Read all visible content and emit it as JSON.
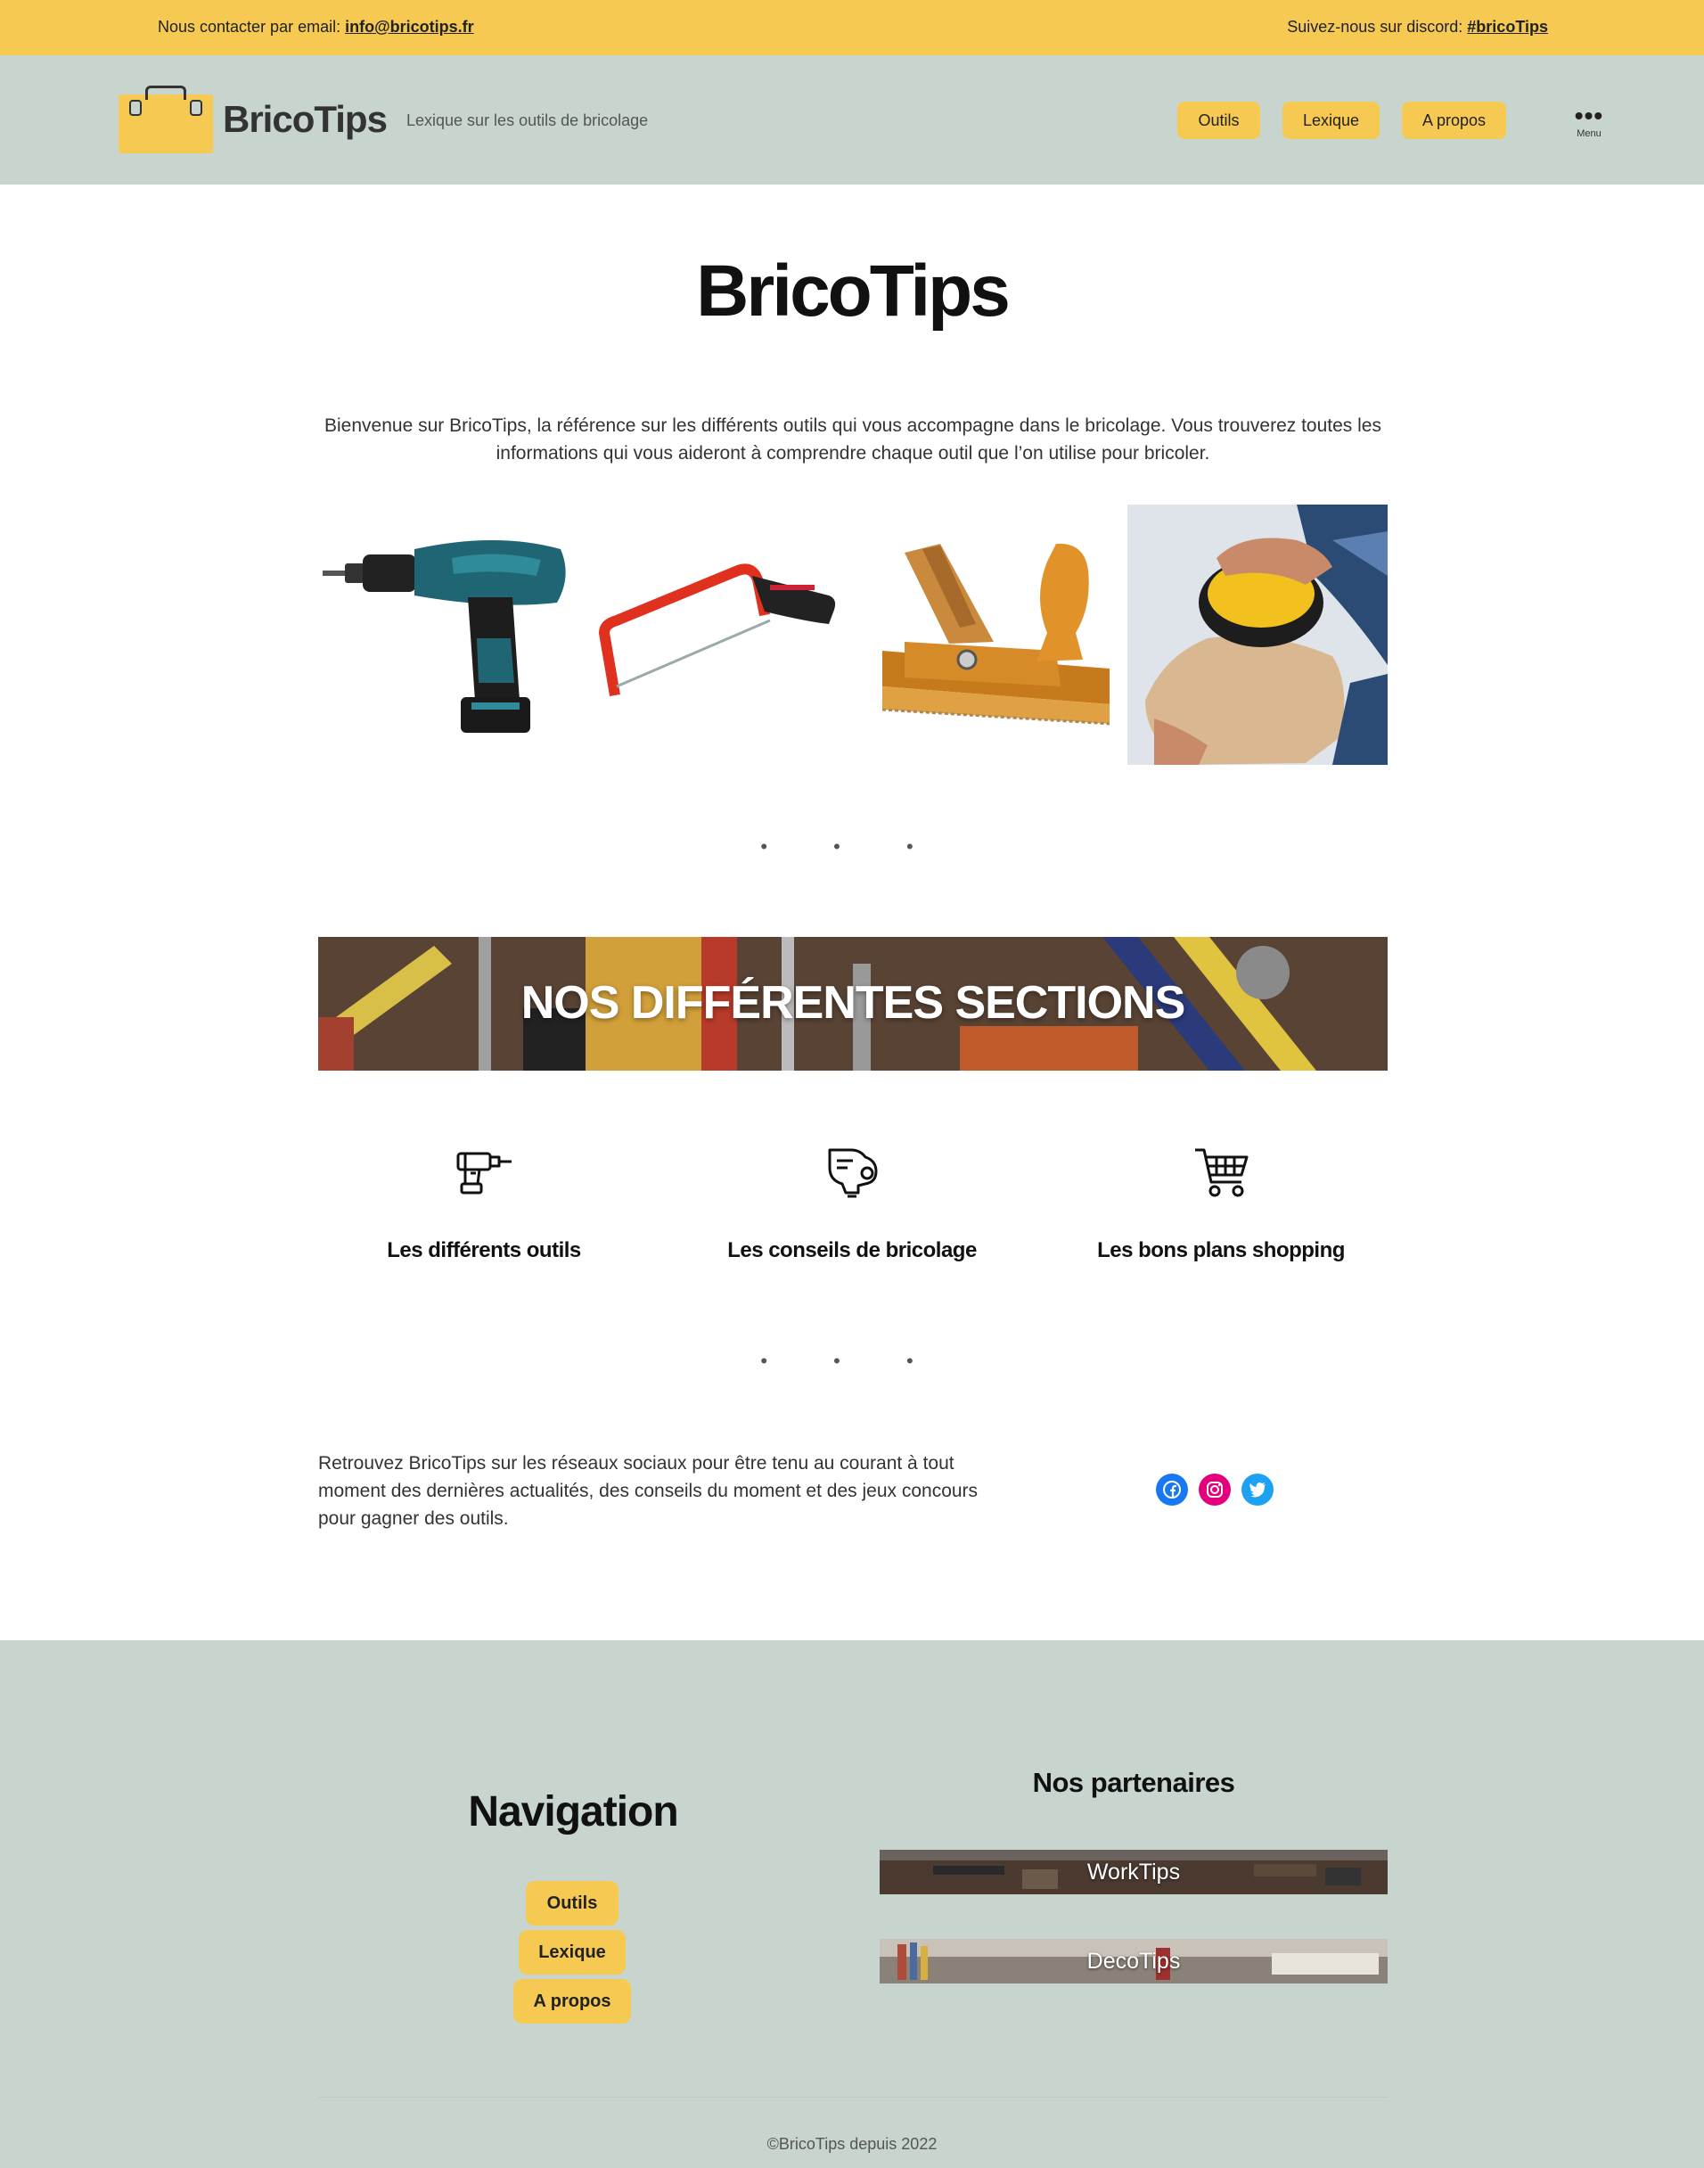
{
  "topbar": {
    "email_prefix": "Nous contacter par email: ",
    "email": "info@bricotips.fr",
    "discord_prefix": "Suivez-nous sur discord: ",
    "discord": "#bricoTips"
  },
  "header": {
    "site_title": "BricoTips",
    "tagline": "Lexique sur les outils de bricolage",
    "nav": [
      "Outils",
      "Lexique",
      "A propos"
    ],
    "menu_label": "Menu"
  },
  "main": {
    "title": "BricoTips",
    "intro": "Bienvenue sur BricoTips, la référence sur les différents outils qui vous accompagne dans le bricolage. Vous trouverez toutes les informations qui vous aideront à comprendre chaque outil que l’on utilise pour bricoler.",
    "images": [
      "drill-image",
      "hacksaw-image",
      "hand-plane-image",
      "sander-image"
    ],
    "sections_banner": "NOS DIFFÉRENTES SECTIONS",
    "sections": [
      {
        "icon": "drill-icon",
        "label": "Les différents outils"
      },
      {
        "icon": "lightbulb-head-icon",
        "label": "Les conseils de bricolage"
      },
      {
        "icon": "shopping-cart-icon",
        "label": "Les bons plans shopping"
      }
    ],
    "social_text": "Retrouvez BricoTips sur les réseaux sociaux pour être tenu au courant à tout moment des dernières actualités, des conseils du moment et des jeux concours pour gagner des outils.",
    "social": [
      {
        "name": "facebook-icon",
        "color": "#1877f2"
      },
      {
        "name": "instagram-icon",
        "color": "#e4007c"
      },
      {
        "name": "twitter-icon",
        "color": "#1da1f2"
      }
    ]
  },
  "footer": {
    "nav_title": "Navigation",
    "nav": [
      "Outils",
      "Lexique",
      "A propos"
    ],
    "partners_title": "Nos partenaires",
    "partners": [
      "WorkTips",
      "DecoTips"
    ],
    "copyright": "©BricoTips depuis 2022"
  },
  "colors": {
    "accent": "#f5c952",
    "header_bg": "#c8d5ce"
  }
}
